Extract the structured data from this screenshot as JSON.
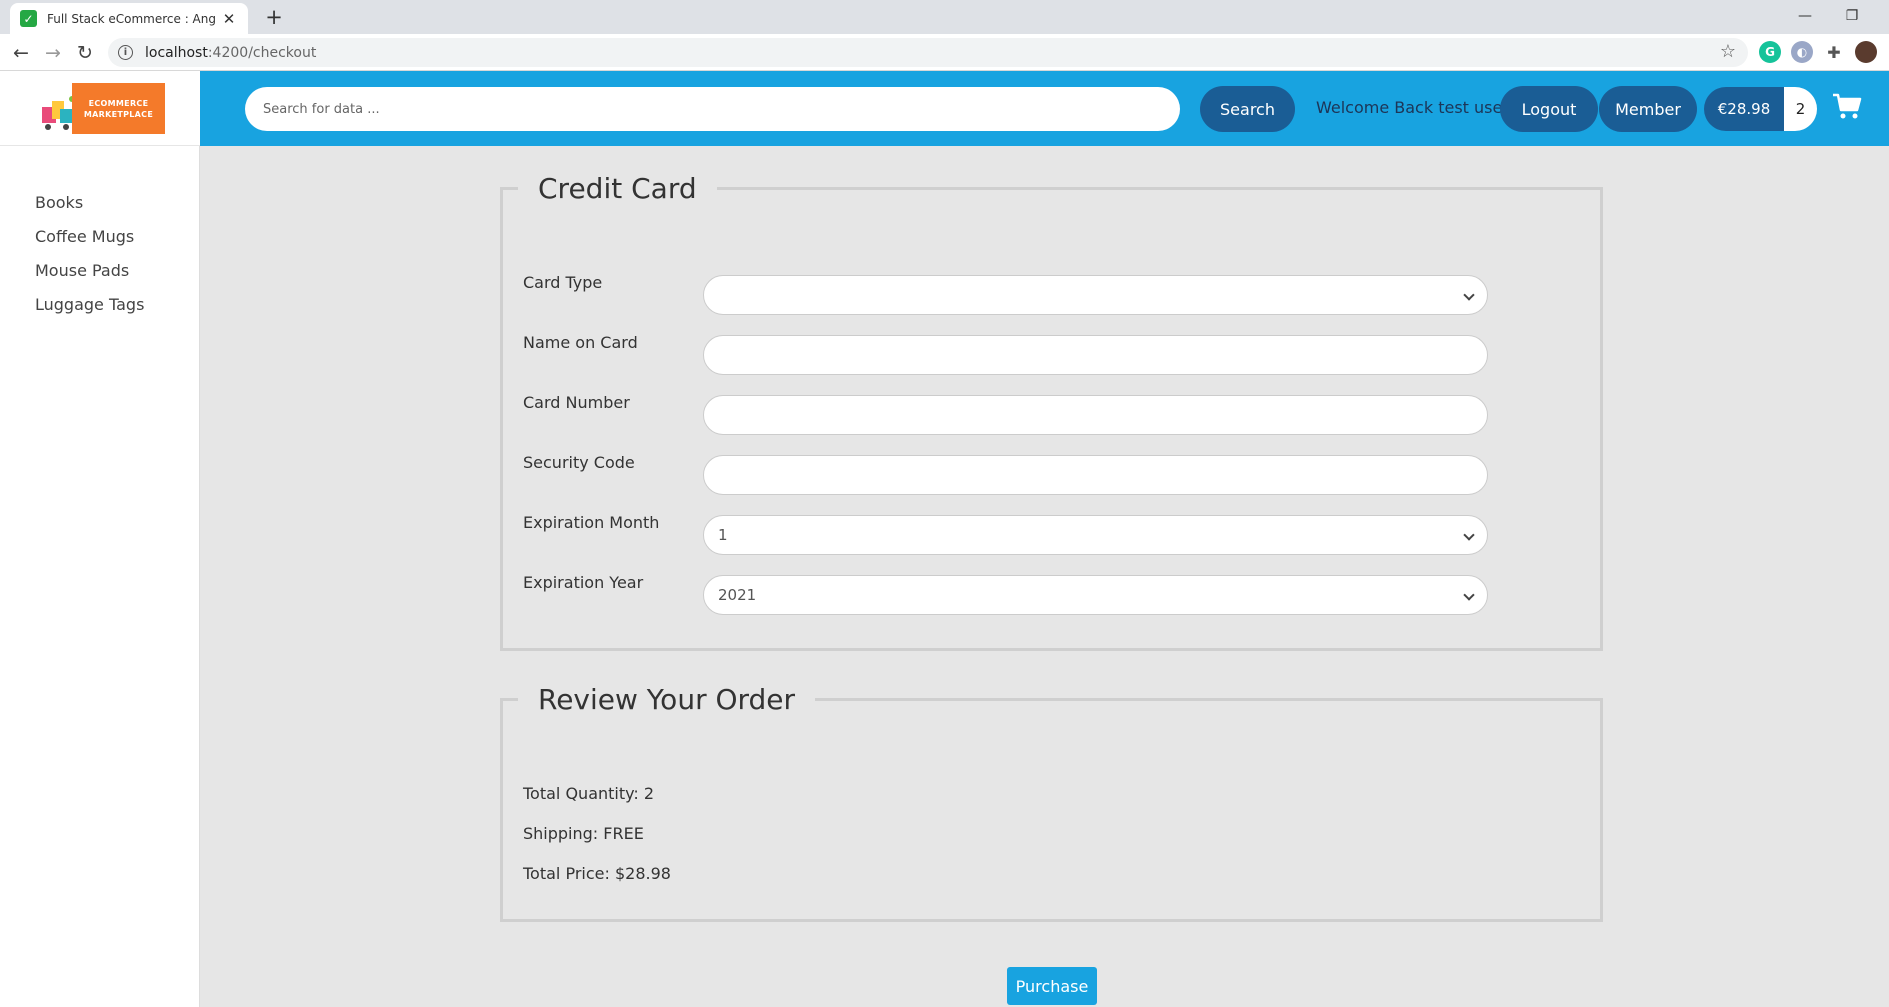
{
  "browser": {
    "tab_title": "Full Stack eCommerce : Angular and Spring Boot",
    "url_host": "localhost",
    "url_rest": ":4200/checkout",
    "new_tab_label": "+",
    "close_tab_label": "✕"
  },
  "app": {
    "logo_line1": "ECOMMERCE",
    "logo_line2": "MARKETPLACE",
    "search": {
      "placeholder": "Search for data ...",
      "button_label": "Search"
    },
    "welcome_text": "Welcome Back test user",
    "logout_label": "Logout",
    "member_label": "Member",
    "cart_total": "€28.98",
    "cart_count": "2"
  },
  "sidebar": {
    "items": [
      {
        "label": "Books"
      },
      {
        "label": "Coffee Mugs"
      },
      {
        "label": "Mouse Pads"
      },
      {
        "label": "Luggage Tags"
      }
    ]
  },
  "credit_card": {
    "legend": "Credit Card",
    "fields": {
      "card_type": {
        "label": "Card Type",
        "value": ""
      },
      "name_on_card": {
        "label": "Name on Card",
        "value": ""
      },
      "card_number": {
        "label": "Card Number",
        "value": ""
      },
      "security_code": {
        "label": "Security Code",
        "value": ""
      },
      "exp_month": {
        "label": "Expiration Month",
        "value": "1"
      },
      "exp_year": {
        "label": "Expiration Year",
        "value": "2021"
      }
    }
  },
  "review": {
    "legend": "Review Your Order",
    "total_quantity": "Total Quantity: 2",
    "shipping": "Shipping: FREE",
    "total_price": "Total Price: $28.98"
  },
  "purchase_label": "Purchase",
  "colors": {
    "header_bg": "#18a3e0",
    "button_dark": "#1a5d95",
    "page_bg": "#e6e6e6",
    "logo_orange": "#f47a2a"
  }
}
